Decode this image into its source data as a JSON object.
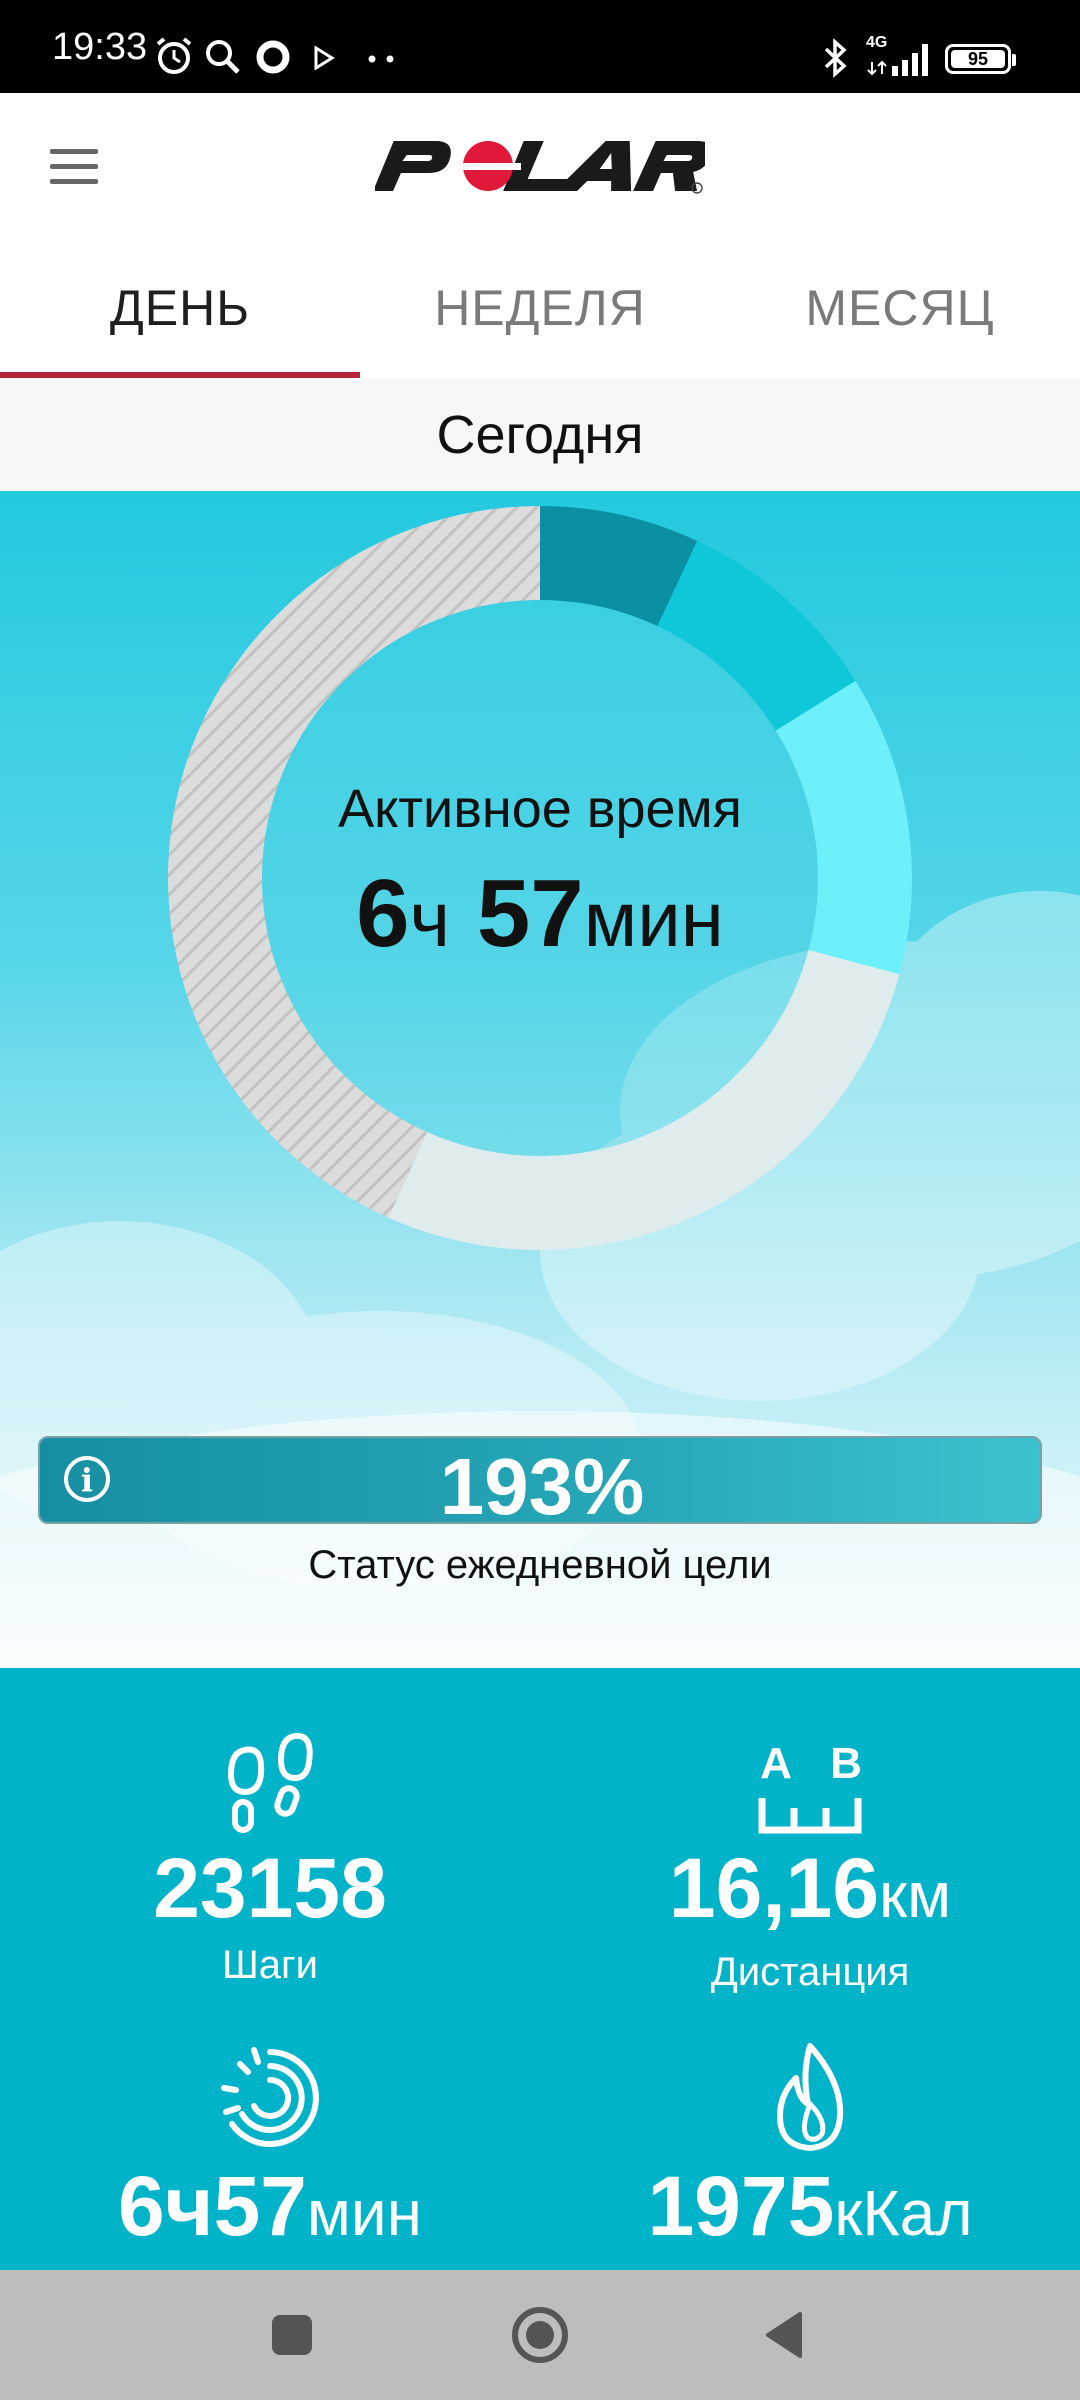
{
  "status_bar": {
    "time": "19:33",
    "network": "4G",
    "battery": "95",
    "icons": [
      "alarm-icon",
      "search-icon",
      "circle-icon",
      "play-icon",
      "dots-icon",
      "bluetooth-icon",
      "signal-icon",
      "battery-icon"
    ]
  },
  "header": {
    "logo_text": "POLAR",
    "menu_icon": "hamburger-menu-icon"
  },
  "tabs": [
    {
      "label": "ДЕНЬ",
      "active": true
    },
    {
      "label": "НЕДЕЛЯ",
      "active": false
    },
    {
      "label": "МЕСЯЦ",
      "active": false
    }
  ],
  "date_label": "Сегодня",
  "activity": {
    "label": "Активное время",
    "hours": "6",
    "hours_unit": "ч",
    "minutes": "57",
    "minutes_unit": "мин"
  },
  "goal": {
    "percent": "193%",
    "caption": "Статус ежедневной цели",
    "info_icon": "info-icon"
  },
  "stats": [
    {
      "icon": "footsteps-icon",
      "value": "23158",
      "unit": "",
      "label": "Шаги"
    },
    {
      "icon": "distance-icon",
      "value": "16,16",
      "unit": "км",
      "label": "Дистанция",
      "icon_text_a": "A",
      "icon_text_b": "B"
    },
    {
      "icon": "active-time-icon",
      "value": "6ч57",
      "unit": "мин",
      "label": ""
    },
    {
      "icon": "flame-icon",
      "value": "1975",
      "unit": "кКал",
      "label": ""
    }
  ],
  "colors": {
    "accent_red": "#b3263a",
    "sky_top": "#23c9df",
    "stats_bg": "#00b3c9",
    "ring_dark": "#0b8fa3",
    "ring_mid": "#10c7d9",
    "ring_light": "#6ef0fb",
    "ring_remaining": "#dfecee",
    "ring_hatched": "#d4d4d4"
  }
}
